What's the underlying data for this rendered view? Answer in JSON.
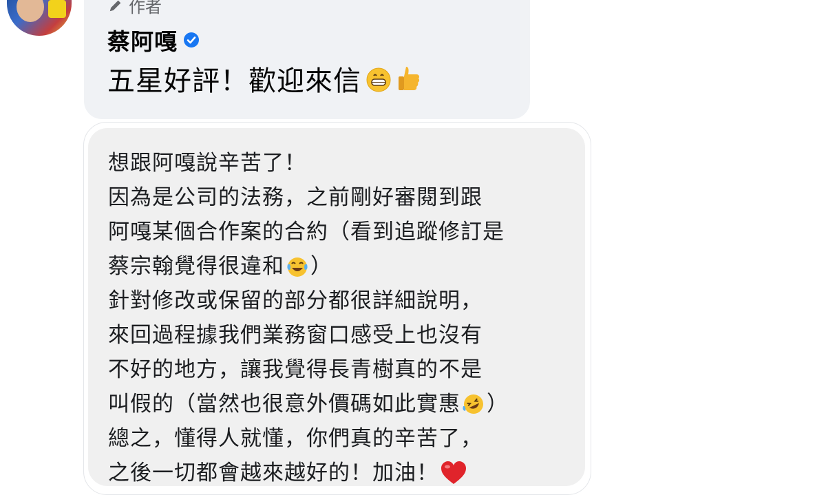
{
  "comment": {
    "author_label": "作者",
    "author_name": "蔡阿嘎",
    "reply_text": "五星好評！歡迎來信",
    "reply_emojis": [
      "grinning-face-icon",
      "thumbs-up-icon"
    ]
  },
  "message": {
    "lines": [
      {
        "text": "想跟阿嘎說辛苦了！"
      },
      {
        "text": "因為是公司的法務，之前剛好審閱到跟"
      },
      {
        "text": "阿嘎某個合作案的合約（看到追蹤修訂是"
      },
      {
        "before": "蔡宗翰覺得很違和",
        "emoji": "tears-of-joy-icon",
        "after": "）"
      },
      {
        "text": "針對修改或保留的部分都很詳細說明，"
      },
      {
        "text": "來回過程據我們業務窗口感受上也沒有"
      },
      {
        "text": "不好的地方，讓我覺得長青樹真的不是"
      },
      {
        "before": "叫假的（當然也很意外價碼如此實惠",
        "emoji": "rolling-laughing-icon",
        "after": "）"
      },
      {
        "text": "總之，懂得人就懂，你們真的辛苦了，"
      },
      {
        "before": "之後一切都會越來越好的！加油！",
        "emoji": "red-heart-icon",
        "after": ""
      }
    ]
  },
  "colors": {
    "bubble_bg": "#f0f2f5",
    "card_bg": "#f0f0f0",
    "verified_blue": "#1877f2",
    "heart_red": "#e0242b"
  }
}
